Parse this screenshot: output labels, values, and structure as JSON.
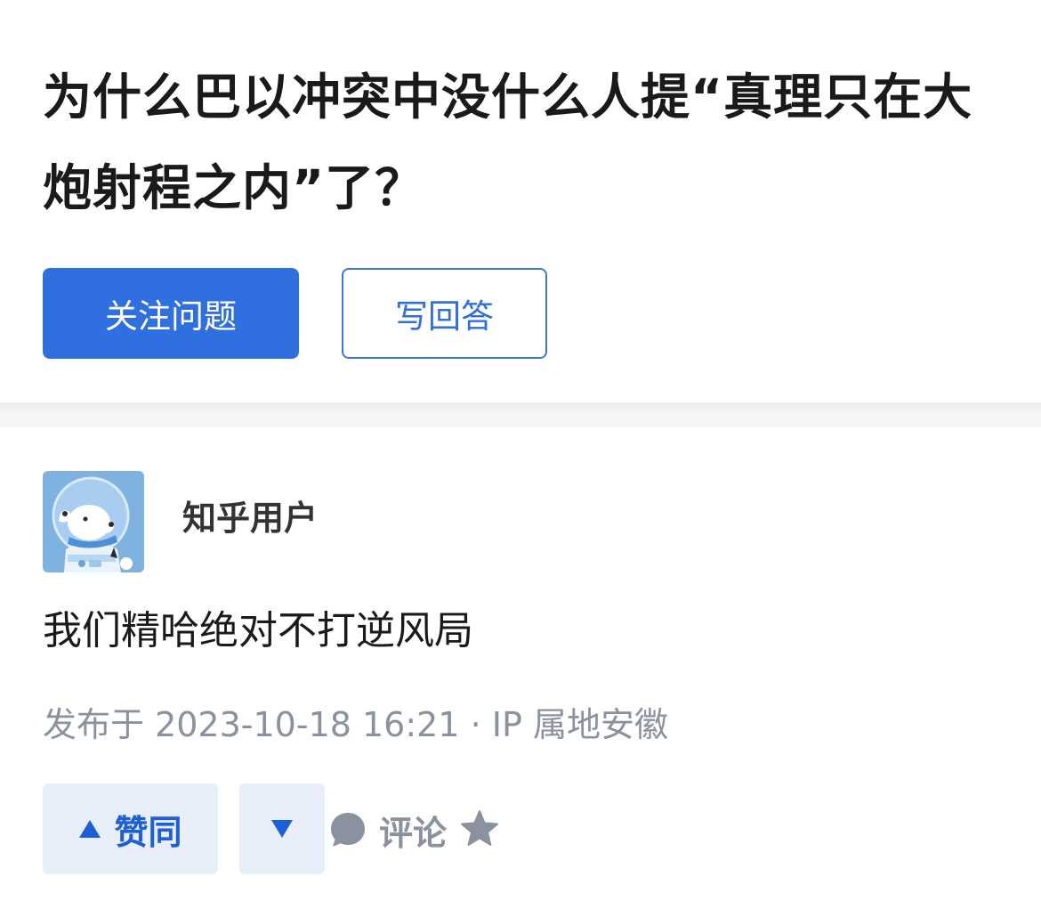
{
  "question": {
    "title": "为什么巴以冲突中没什么人提“真理只在大炮射程之内”了？",
    "follow_label": "关注问题",
    "write_answer_label": "写回答"
  },
  "answer": {
    "author": {
      "name": "知乎用户",
      "avatar_icon": "astronaut-dog-avatar"
    },
    "content": "我们精哈绝对不打逆风局",
    "meta": "发布于 2023-10-18 16:21 · IP 属地安徽"
  },
  "actions": {
    "upvote_label": "赞同",
    "comment_label": "评论",
    "upvote_icon": "triangle-up-icon",
    "downvote_icon": "triangle-down-icon",
    "comment_icon": "comment-bubble-icon",
    "collect_icon": "star-icon"
  },
  "colors": {
    "brand_blue": "#2f6fe0",
    "vote_bg": "#e8effb",
    "meta_gray": "#8a919f",
    "divider_gray": "#f6f6f6"
  }
}
